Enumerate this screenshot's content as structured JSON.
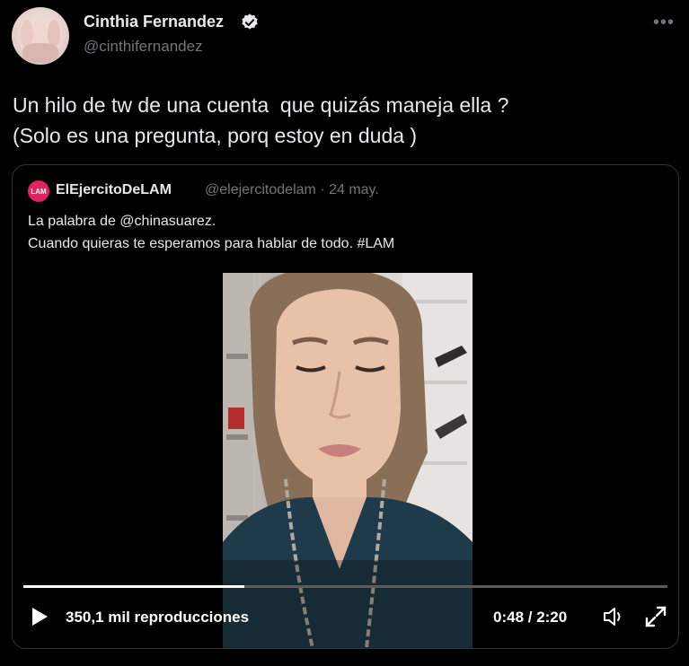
{
  "author": {
    "name": "Cinthia Fernandez",
    "handle": "@cinthifernandez",
    "verified": true
  },
  "icons": {
    "more": "more-icon",
    "verified": "verified-badge-icon",
    "play": "play-icon",
    "volume": "volume-icon",
    "fullscreen": "fullscreen-icon"
  },
  "tweet": {
    "text": "Un hilo de tw de una cuenta  que quizás maneja ella ?\n(Solo es una pregunta, porq estoy en duda )"
  },
  "quote": {
    "avatar_text": "LAM",
    "name": "ElEjercitoDeLAM",
    "handle": "@elejercitodelam",
    "date": "24 may.",
    "meta": "@elejercitodelam · 24 may.",
    "text": "La palabra de @chinasuarez.\nCuando quieras te esperamos para hablar de todo. #LAM"
  },
  "video": {
    "views": "350,1 mil reproducciones",
    "time": "0:48 / 2:20",
    "progress": 0.343
  },
  "colors": {
    "background": "#000000",
    "text": "#e7e9ea",
    "secondary": "#71767b",
    "border": "#333333",
    "brand_red": "#e0245e"
  }
}
